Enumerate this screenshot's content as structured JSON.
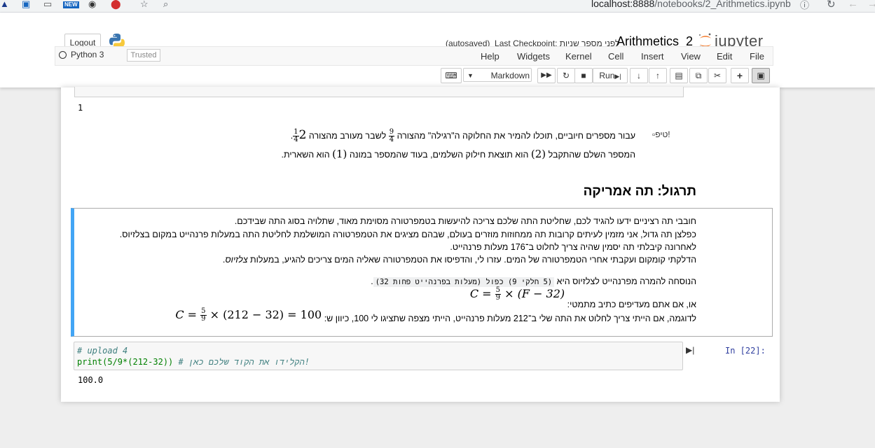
{
  "browser": {
    "url_host": "localhost:8888",
    "url_path": "/notebooks/2_Arithmetics.ipynb",
    "new_badge": "NEW"
  },
  "header": {
    "logout_label": "Logout",
    "logo_text": "jupyter",
    "notebook_title": "Arithmetics_2",
    "checkpoint_text": "Last Checkpoint: לפני מספר שניות",
    "autosaved": "(autosaved)"
  },
  "menu": {
    "items": [
      "File",
      "Edit",
      "View",
      "Insert",
      "Cell",
      "Kernel",
      "Widgets",
      "Help"
    ],
    "trusted": "Trusted",
    "kernel": "Python 3"
  },
  "toolbar": {
    "run_label": "Run",
    "cell_type": "Markdown",
    "icons": [
      "save-icon",
      "plus-icon",
      "cut-icon",
      "copy-icon",
      "paste-icon",
      "arrow-up-icon",
      "arrow-down-icon",
      "run-icon",
      "stop-icon",
      "restart-icon",
      "fast-forward-icon",
      "keyboard-icon"
    ]
  },
  "cells": {
    "prev_output": "1",
    "tip": {
      "img_alt": "טיפ!",
      "line1_a": "עבור מספרים חיוביים, תוכלו להמיר את החלוקה ה\"רגילה\" מהצורה",
      "line1_b": "לשבר מעורב מהצורה",
      "line1_frac_num": "9",
      "line1_frac_den": "4",
      "mixed_whole": "2",
      "mixed_num": "1",
      "mixed_den": "4",
      "line2_a": "המספר השלם שהתקבל",
      "line2_val1": "(2)",
      "line2_b": "הוא תוצאת חילוק השלמים, בעוד שהמספר במונה",
      "line2_val2": "(1)",
      "line2_c": "הוא השארית."
    },
    "heading": "תרגול: תה אמריקה",
    "exercise": {
      "p1": "חובבי תה רציניים ידעו להגיד לכם, שחליטת התה שלכם צריכה להיעשות בטמפרטורה מסוימת מאוד, שתלויה בסוג התה שבידכם.",
      "p2": "כפלצן תה גדול, אני מזמין לעיתים קרובות תה ממחוזות מוזרים בעולם, שבהם מציגים את הטמפרטורה המושלמת לחליטת התה במעלות פרנהייט במקום בצלזיוס.",
      "p3": "לאחרונה קיבלתי תה יסמין שהיה צריך לחלוט ב־176 מעלות פרנהייט.",
      "p4_a": "הדלקתי קומקום ועקבתי אחרי הטמפרטורה של המים. עזרו לי, והדפיסו את הטמפרטורה שאליה המים צריכים להגיע, במעלות ",
      "p4_em": "צלזיוס",
      "formula_intro": "הנוסחה להמרה מפרנהייט לצלזיוס היא",
      "formula_code": "(5 חלקי 9) כפול (מעלות בפרנהייט פחות 32)",
      "or_text": "או, אם אתם מעדיפים כתיב מתמטי:",
      "math1_lhs": "C =",
      "math1_num": "5",
      "math1_den": "9",
      "math1_rhs": "× (F − 32)",
      "example_text": "לדוגמה, אם הייתי צריך לחלוט את התה שלי ב־212 מעלות פרנהייט, הייתי מצפה שתציגו לי 100, כיוון ש:",
      "math2_lhs": "C =",
      "math2_num": "5",
      "math2_den": "9",
      "math2_rhs": "× (212 − 32) = 100"
    },
    "code": {
      "prompt": "In [22]:",
      "line1": "# upload 4",
      "line2_code": "print(5/9*(212-32))",
      "line2_comment": " # הקלידו את הקוד שלכם כאן!",
      "output": "100.0"
    }
  }
}
